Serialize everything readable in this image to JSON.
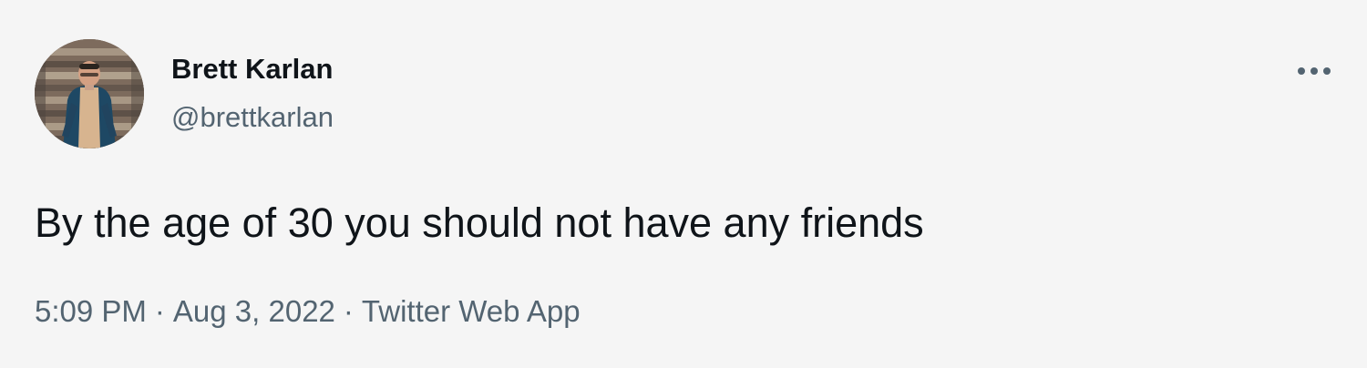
{
  "tweet": {
    "author": {
      "display_name": "Brett Karlan",
      "handle": "@brettkarlan"
    },
    "text": "By the age of 30 you should not have any friends",
    "meta": {
      "time": "5:09 PM",
      "separator": "·",
      "date": "Aug 3, 2022",
      "source": "Twitter Web App"
    },
    "icons": {
      "more": "more-horizontal-icon",
      "avatar": "profile-photo"
    }
  }
}
